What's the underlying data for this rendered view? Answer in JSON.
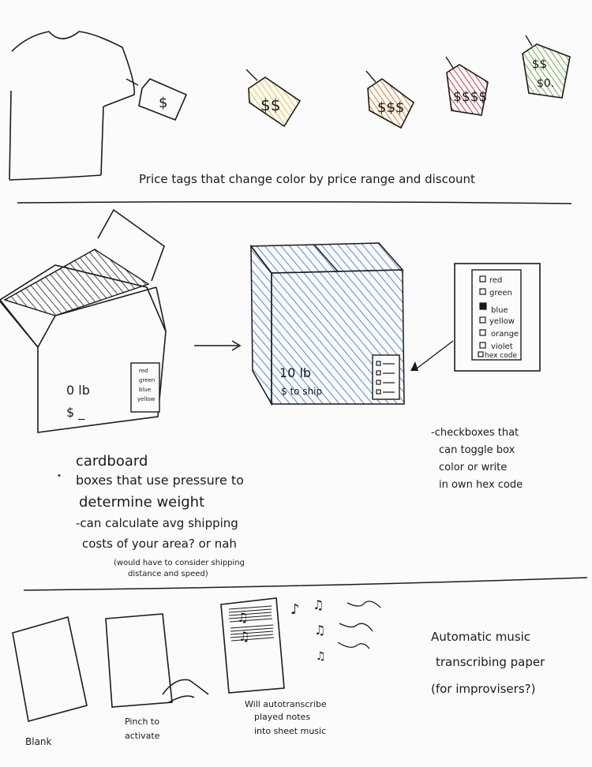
{
  "section1": {
    "tag_symbols": [
      "$",
      "$$",
      "$$$",
      "$$$$",
      "$$",
      "$0."
    ],
    "caption": "Price tags that change color by price range and discount",
    "tag_colors": [
      "#e8cf3a",
      "#e08a2e",
      "#cf3c4c",
      "#6ab04c"
    ]
  },
  "section2": {
    "small_box": {
      "weight": "0 lb",
      "price": "$ _",
      "panel_options": [
        "red",
        "green",
        "blue",
        "yellow"
      ]
    },
    "blue_box": {
      "weight": "10 lb",
      "price": "$ to ship",
      "color": "#3d7fd6"
    },
    "panel": {
      "options": [
        "red",
        "green",
        "blue",
        "yellow",
        "orange",
        "violet",
        "hex code"
      ],
      "checked_option": "blue"
    },
    "notes_left": [
      "cardboard",
      "boxes that use pressure to",
      "determine weight",
      "-can calculate avg shipping",
      "costs of your area? or nah",
      "(would have to consider shipping",
      "distance and speed)"
    ],
    "notes_right": [
      "-checkboxes that",
      "can toggle box",
      "color  or write",
      "in own hex code"
    ]
  },
  "section3": {
    "labels": {
      "blank": "Blank",
      "pinch": [
        "Pinch to",
        "activate"
      ],
      "auto": [
        "Will autotranscribe",
        "played notes",
        "into sheet music"
      ]
    },
    "title": [
      "Automatic music",
      "transcribing paper",
      "(for improvisers?)"
    ],
    "notes_glyphs": [
      "♪",
      "♫",
      "♫",
      "♫"
    ]
  }
}
